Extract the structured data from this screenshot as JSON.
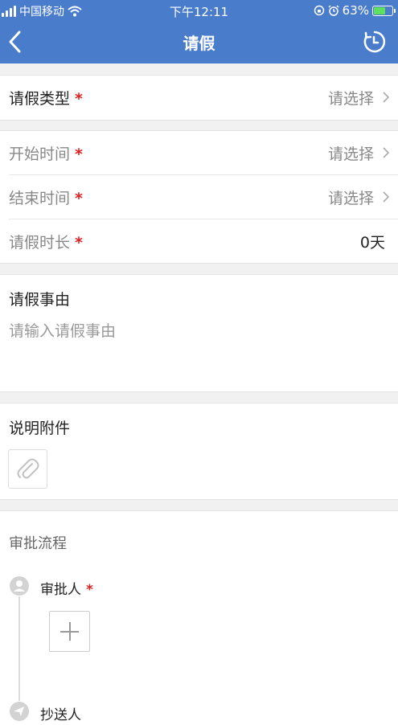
{
  "status_bar": {
    "carrier": "中国移动",
    "time": "下午12:11",
    "battery_percent": "63%",
    "battery_level": 0.63
  },
  "nav": {
    "title": "请假",
    "back_icon": "chevron-left-icon",
    "history_icon": "clock-history-icon"
  },
  "form": {
    "leave_type": {
      "label": "请假类型",
      "required_mark": "*",
      "value": "请选择"
    },
    "start_time": {
      "label": "开始时间",
      "required_mark": "*",
      "value": "请选择"
    },
    "end_time": {
      "label": "结束时间",
      "required_mark": "*",
      "value": "请选择"
    },
    "duration": {
      "label": "请假时长",
      "required_mark": "*",
      "value": "0天"
    },
    "reason": {
      "label": "请假事由",
      "placeholder": "请输入请假事由"
    },
    "attachment": {
      "label": "说明附件",
      "icon": "paperclip-icon"
    }
  },
  "approval": {
    "title": "审批流程",
    "approver": {
      "label": "审批人",
      "required_mark": "*",
      "icon": "user-icon",
      "add_icon": "plus-icon"
    },
    "cc": {
      "label": "抄送人",
      "icon": "send-icon"
    }
  },
  "colors": {
    "header": "#4a7ccc",
    "required": "#e02020",
    "background": "#f1f1f1"
  }
}
